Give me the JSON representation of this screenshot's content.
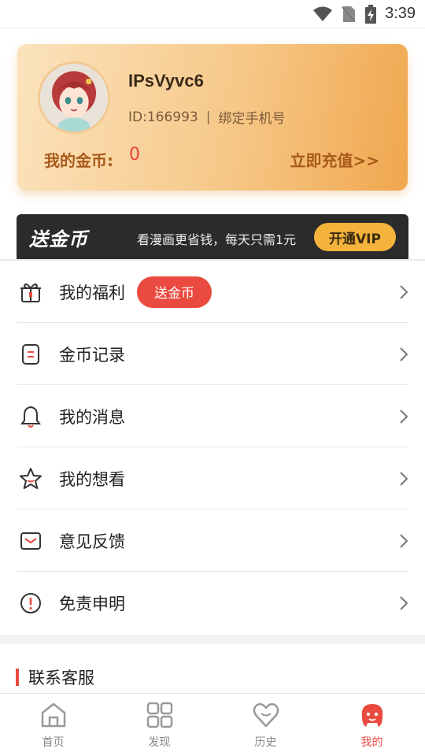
{
  "status_bar": {
    "time": "3:39"
  },
  "profile": {
    "username": "IPsVyvc6",
    "id_text": "ID:166993",
    "separator": "|",
    "bind_phone": "绑定手机号",
    "coins_label": "我的金币:",
    "coins_value": "0",
    "recharge_label": "立即充值>>"
  },
  "vip_banner": {
    "title": "送金币",
    "promo_text": "看漫画更省钱，每天只需1元",
    "button_label": "开通VIP"
  },
  "menu": {
    "items": [
      {
        "label": "我的福利",
        "icon": "gift-icon",
        "badge": "送金币"
      },
      {
        "label": "金币记录",
        "icon": "coin-record-icon"
      },
      {
        "label": "我的消息",
        "icon": "bell-icon"
      },
      {
        "label": "我的想看",
        "icon": "star-icon"
      },
      {
        "label": "意见反馈",
        "icon": "mail-icon"
      },
      {
        "label": "免责申明",
        "icon": "alert-icon"
      }
    ]
  },
  "contact": {
    "title": "联系客服"
  },
  "bottom_nav": {
    "items": [
      {
        "label": "首页",
        "icon": "home-icon",
        "active": false
      },
      {
        "label": "发现",
        "icon": "grid-icon",
        "active": false
      },
      {
        "label": "历史",
        "icon": "heart-icon",
        "active": false
      },
      {
        "label": "我的",
        "icon": "profile-face-icon",
        "active": true
      }
    ]
  },
  "colors": {
    "accent_red": "#ea4a3f",
    "gold": "#f4b33a",
    "card_brown": "#a85a1a",
    "banner_dark": "#2b2b2b"
  }
}
